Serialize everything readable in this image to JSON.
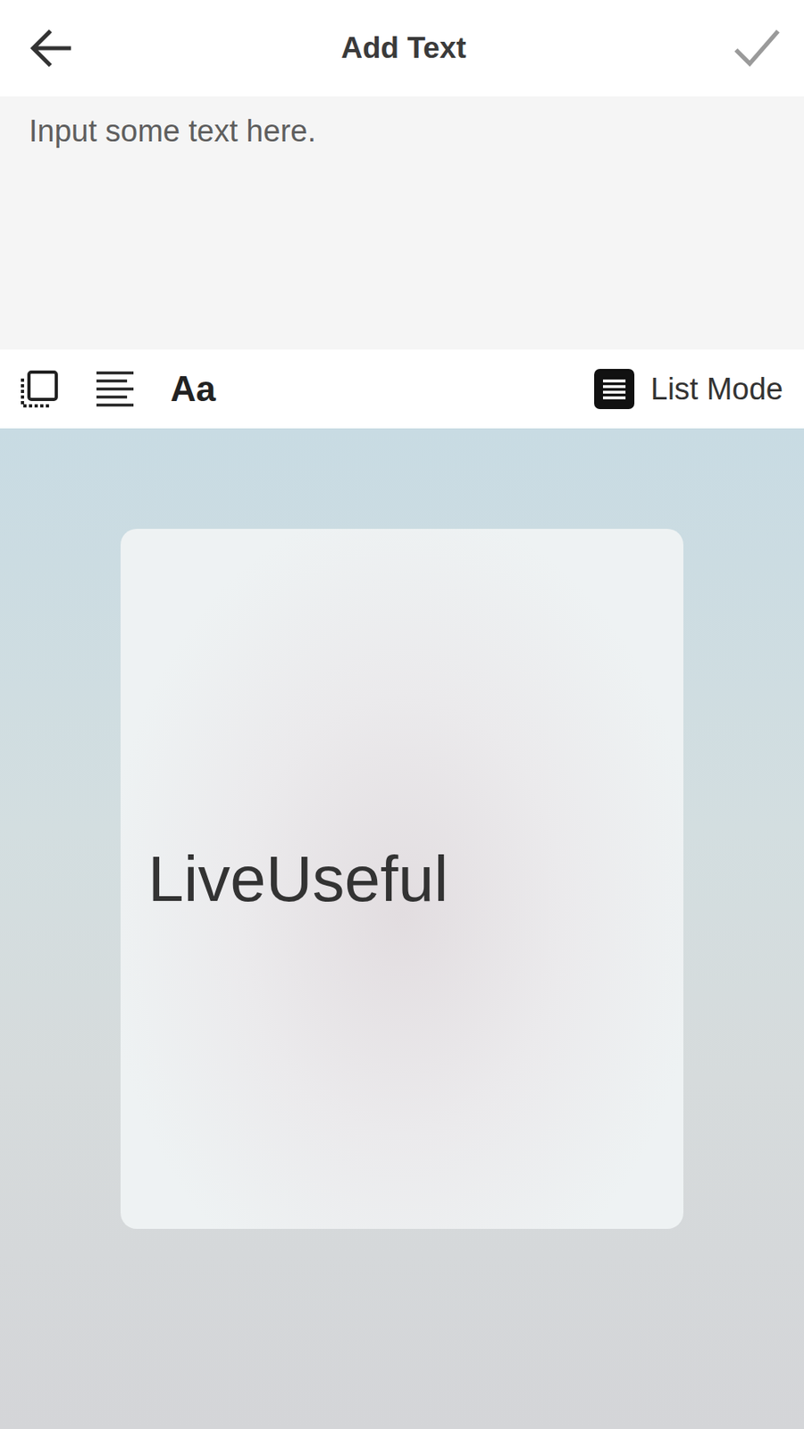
{
  "header": {
    "title": "Add Text",
    "confirm": {
      "disabled": true
    }
  },
  "input": {
    "placeholder": "Input some text here."
  },
  "toolbar": {
    "font_button": "Aa",
    "mode_button": {
      "label": "List Mode"
    }
  },
  "preview": {
    "text": "LiveUseful"
  }
}
